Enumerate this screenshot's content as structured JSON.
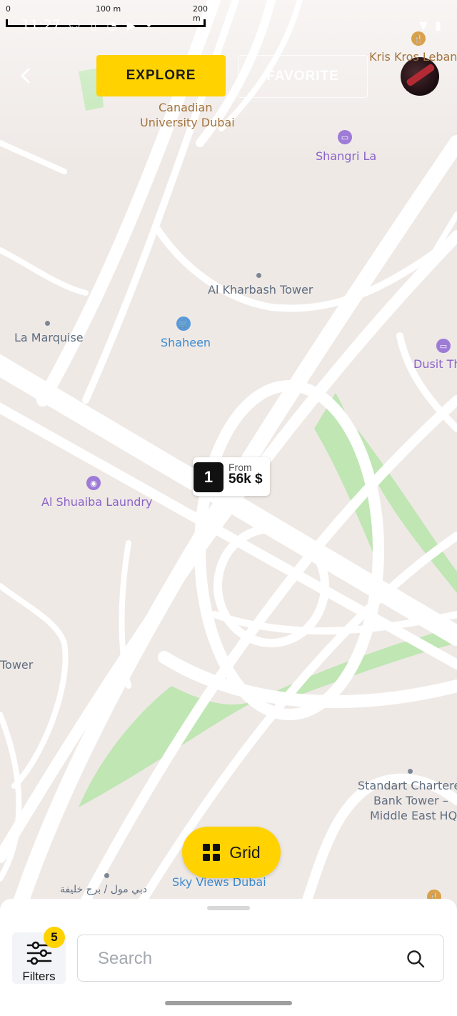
{
  "status_bar": {
    "time": "11:27"
  },
  "scale_bar": {
    "ticks": [
      "0",
      "100 m",
      "200 m"
    ]
  },
  "header": {
    "tabs": [
      {
        "label": "EXPLORE",
        "active": true
      },
      {
        "label": "FAVORITE",
        "active": false
      }
    ]
  },
  "map": {
    "labels": {
      "kris_kros": "Kris Kros Lebane",
      "canadian_university_line1": "Canadian",
      "canadian_university_line2": "University Dubai",
      "shangri_la": "Shangri La",
      "al_kharbash_tower": "Al Kharbash Tower",
      "la_marquise": "La Marquise",
      "shaheen": "Shaheen",
      "dusit": "Dusit Th",
      "al_shuaiba_laundry": "Al Shuaiba Laundry",
      "tower": "Tower",
      "standart_line1": "Standart Chartere",
      "standart_line2": "Bank Tower –",
      "standart_line3": "Middle East HQ",
      "sky_views": "Sky Views Dubai",
      "dubai_mall_arabic": "دبي مول / برج خليفة"
    },
    "marker": {
      "count": "1",
      "from_label": "From",
      "price": "56k $"
    }
  },
  "grid_button": {
    "label": "Grid"
  },
  "bottom_sheet": {
    "filters_label": "Filters",
    "filters_count": "5",
    "search_placeholder": "Search"
  },
  "colors": {
    "accent": "#ffd200",
    "map_bg": "#efe9e6",
    "road": "#ffffff",
    "park": "#bfe6b3"
  }
}
